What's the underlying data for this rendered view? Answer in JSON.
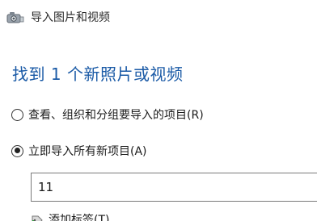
{
  "window": {
    "title": "导入图片和视频",
    "icon": "import-camera-icon"
  },
  "main": {
    "heading": "找到 1 个新照片或视频",
    "options": [
      {
        "label": "查看、组织和分组要导入的项目(R)",
        "selected": false
      },
      {
        "label": "立即导入所有新项目(A)",
        "selected": true
      }
    ],
    "tag_input": {
      "value": "11"
    },
    "add_tags": {
      "label": "添加标签(T)",
      "icon": "add-tag-icon"
    }
  },
  "colors": {
    "heading": "#1a5aa6",
    "text": "#1b1b1b"
  }
}
